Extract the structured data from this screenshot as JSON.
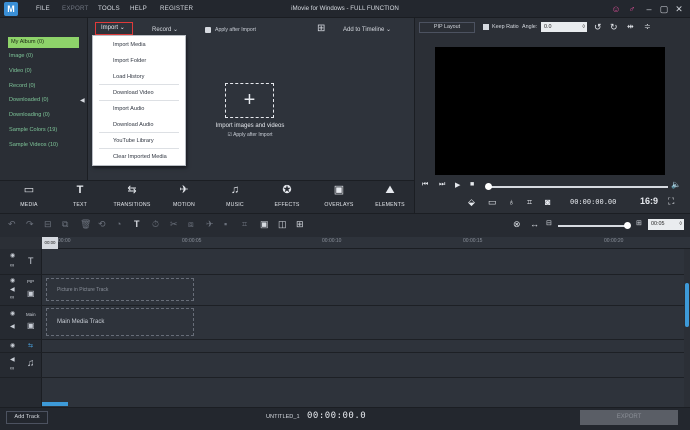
{
  "titlebar": {
    "title": "iMovie for Windows - FULL FUNCTION",
    "menu": [
      "FILE",
      "EXPORT",
      "TOOLS",
      "HELP",
      "REGISTER"
    ]
  },
  "album": {
    "items": [
      "My Album (0)",
      "Image (0)",
      "Video (0)",
      "Record (0)",
      "Downloaded (0)",
      "Downloading (0)",
      "Sample Colors (19)",
      "Sample Videos (10)"
    ]
  },
  "library_toolbar": {
    "import_label": "Import",
    "record_label": "Record",
    "apply_label": "Apply after Import",
    "add_to_timeline": "Add to Timeline"
  },
  "import_menu": [
    "Import Media",
    "Import Folder",
    "Load History",
    "Download Video",
    "Import Audio",
    "Download Audio",
    "YouTube Library",
    "Clear Imported Media"
  ],
  "drop_area": {
    "text": "Import images and videos",
    "sub": "Apply after Import"
  },
  "categories": [
    {
      "icon": "media-icon",
      "label": "MEDIA"
    },
    {
      "icon": "text-icon",
      "label": "TEXT"
    },
    {
      "icon": "transitions-icon",
      "label": "TRANSITIONS"
    },
    {
      "icon": "motion-icon",
      "label": "MOTION"
    },
    {
      "icon": "music-icon",
      "label": "MUSIC"
    },
    {
      "icon": "effects-icon",
      "label": "EFFECTS"
    },
    {
      "icon": "overlays-icon",
      "label": "OVERLAYS"
    },
    {
      "icon": "elements-icon",
      "label": "ELEMENTS"
    }
  ],
  "preview": {
    "pip_label": "PIP Layout",
    "keep_ratio": "Keep Ratio",
    "angle_label": "Angle:",
    "angle_value": "0.0",
    "timecode": "00:00:00.00",
    "aspect": "16:9"
  },
  "timeline": {
    "zoom_value": "00:05",
    "ruler": [
      "00:00",
      "00:00:05",
      "00:00:10",
      "00:00:15",
      "00:00:20"
    ],
    "playhead": "00:00",
    "tracks": [
      {
        "name": "",
        "slot": ""
      },
      {
        "name": "PIP",
        "slot": "Picture in Picture Track"
      },
      {
        "name": "Main",
        "slot": "Main Media Track"
      }
    ]
  },
  "bottombar": {
    "add_track": "Add Track",
    "project": "UNTITLED_1",
    "timecode": "00:00:00.0",
    "export": "EXPORT"
  }
}
